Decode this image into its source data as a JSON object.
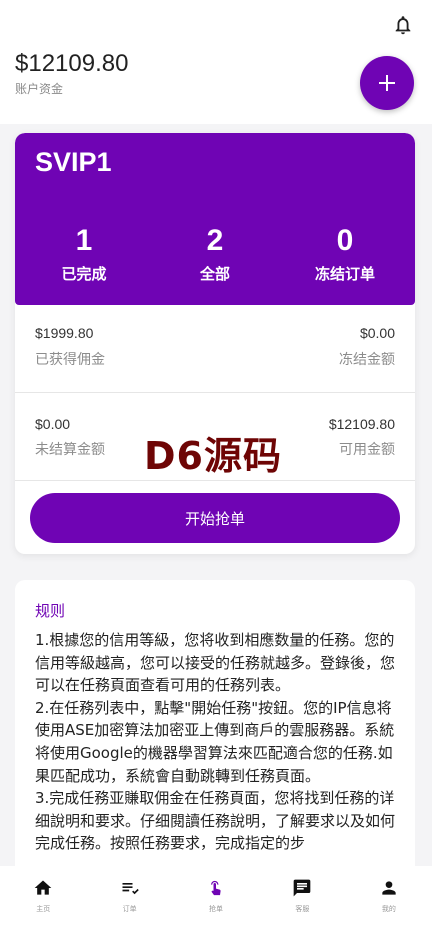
{
  "header": {
    "balance": "$12109.80",
    "balance_label": "账户资金",
    "fab_label": "+"
  },
  "vip": {
    "level": "SVIP1",
    "stats": [
      {
        "value": "1",
        "label": "已完成"
      },
      {
        "value": "2",
        "label": "全部"
      },
      {
        "value": "0",
        "label": "冻结订单"
      }
    ]
  },
  "funds": {
    "earned_commission": "$1999.80",
    "earned_commission_label": "已获得佣金",
    "frozen_amount": "$0.00",
    "frozen_amount_label": "冻结金额",
    "unsettled_amount": "$0.00",
    "unsettled_amount_label": "未结算金额",
    "available_amount": "$12109.80",
    "available_amount_label": "可用金额"
  },
  "start_button_label": "开始抢单",
  "watermark": "D6源码",
  "rules": {
    "title": "规则",
    "paragraphs": [
      "1.根據您的信用等級，您将收到相應数量的任務。您的信用等級越高，您可以接受的任務就越多。登錄後，您可以在任務頁面查看可用的任務列表。",
      "2.在任務列表中，點擊\"開始任務\"按鈕。您的IP信息将使用ASE加密算法加密亚上傳到商戶的雲服務器。系統将使用Google的機器學習算法來匹配適合您的任務.如果匹配成功，系統會自動跳轉到任務頁面。",
      "3.完成任務亚賺取佣金在任務頁面，您将找到任務的详细說明和要求。仔细閱讀任務說明，了解要求以及如何完成任務。按照任務要求，完成指定的步"
    ]
  },
  "tabs": [
    {
      "label": "主页",
      "icon": "home-icon"
    },
    {
      "label": "订单",
      "icon": "checklist-icon"
    },
    {
      "label": "抢单",
      "icon": "tap-icon"
    },
    {
      "label": "客服",
      "icon": "chat-icon"
    },
    {
      "label": "我的",
      "icon": "person-icon"
    }
  ],
  "colors": {
    "accent": "#6f04b4",
    "watermark": "#6e0505"
  }
}
